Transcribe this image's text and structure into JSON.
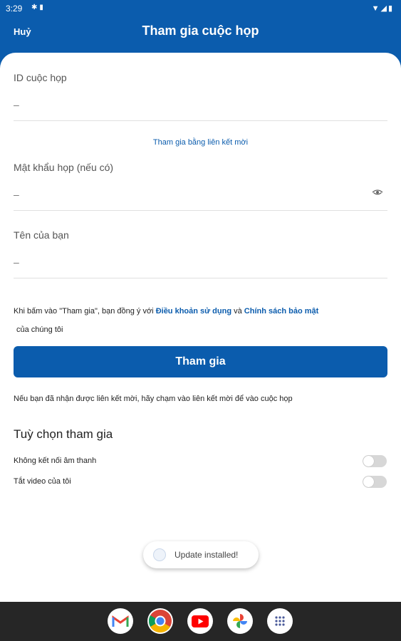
{
  "status_bar": {
    "time": "3:29",
    "left_icons": [
      "settings-gear-icon",
      "sim-card-icon"
    ],
    "right_icons": [
      "wifi-icon",
      "cellular-signal-icon",
      "battery-icon"
    ]
  },
  "header": {
    "cancel_label": "Huỷ",
    "title": "Tham gia cuộc họp"
  },
  "form": {
    "meeting_id": {
      "label": "ID cuộc họp",
      "value": "",
      "placeholder": "–"
    },
    "invite_link_label": "Tham gia bằng liên kết mời",
    "password": {
      "label": "Mật khẩu họp (nếu có)",
      "value": "",
      "placeholder": "–"
    },
    "name": {
      "label": "Tên của bạn",
      "value": "",
      "placeholder": "–"
    }
  },
  "terms": {
    "prefix": "Khi bấm vào \"Tham gia\", bạn đồng ý với ",
    "terms_link": "Điều khoản sử dụng",
    "connector": " và ",
    "privacy_link": "Chính sách bảo mật",
    "suffix": "của chúng tôi"
  },
  "join_button_label": "Tham gia",
  "invite_hint": "Nếu bạn đã nhận được liên kết mời, hãy chạm vào liên kết mời để vào cuộc họp",
  "options": {
    "title": "Tuỳ chọn tham gia",
    "items": [
      {
        "label": "Không kết nối âm thanh",
        "enabled": false
      },
      {
        "label": "Tắt video của tôi",
        "enabled": false
      }
    ]
  },
  "toast": {
    "text": "Update installed!"
  },
  "dock": {
    "apps": [
      "gmail-icon",
      "chrome-icon",
      "youtube-icon",
      "photos-icon",
      "app-drawer-icon"
    ]
  },
  "colors": {
    "primary": "#0b5cad",
    "nav_bar": "#262626"
  }
}
